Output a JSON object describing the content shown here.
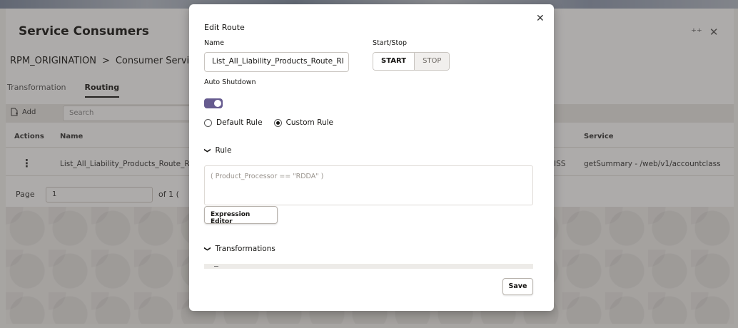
{
  "background": {
    "page_title": "Service Consumers",
    "window_controls": [
      "⁺⁺",
      "✕"
    ],
    "breadcrumb": {
      "root": "RPM_ORIGINATION",
      "separator": ">",
      "current": "Consumer Service"
    },
    "tabs": [
      {
        "label": "Transformation",
        "active": false
      },
      {
        "label": "Routing",
        "active": true
      }
    ],
    "toolbar": {
      "add_label": "Add",
      "search_placeholder": "Search"
    },
    "table": {
      "columns": {
        "actions": "Actions",
        "name": "Name",
        "service": "Service"
      },
      "rows": [
        {
          "actions_icon": "⋮",
          "name": "List_All_Liability_Products_Route_RI",
          "mid_fragment": "ISS",
          "service": "getSummary - /web/v1/accountclass"
        }
      ]
    },
    "pager": {
      "label": "Page",
      "value": "1",
      "of": "of 1  ("
    }
  },
  "dialog": {
    "title": "Edit Route",
    "close_icon": "✕",
    "name_label": "Name",
    "name_value": "List_All_Liability_Products_Route_RI",
    "start_stop_label": "Start/Stop",
    "start_label": "START",
    "stop_label": "STOP",
    "auto_shutdown_label": "Auto Shutdown",
    "auto_shutdown_on": true,
    "rules": [
      {
        "label": "Default Rule",
        "checked": false
      },
      {
        "label": "Custom Rule",
        "checked": true
      }
    ],
    "rule_section": "Rule",
    "rule_expression": "( Product_Processor == \"RDDA\" )",
    "expression_editor_label": "Expression Editor",
    "transformations_section": "Transformations",
    "save_label": "Save",
    "colors": {
      "toggle_on": "#665b8f"
    }
  }
}
